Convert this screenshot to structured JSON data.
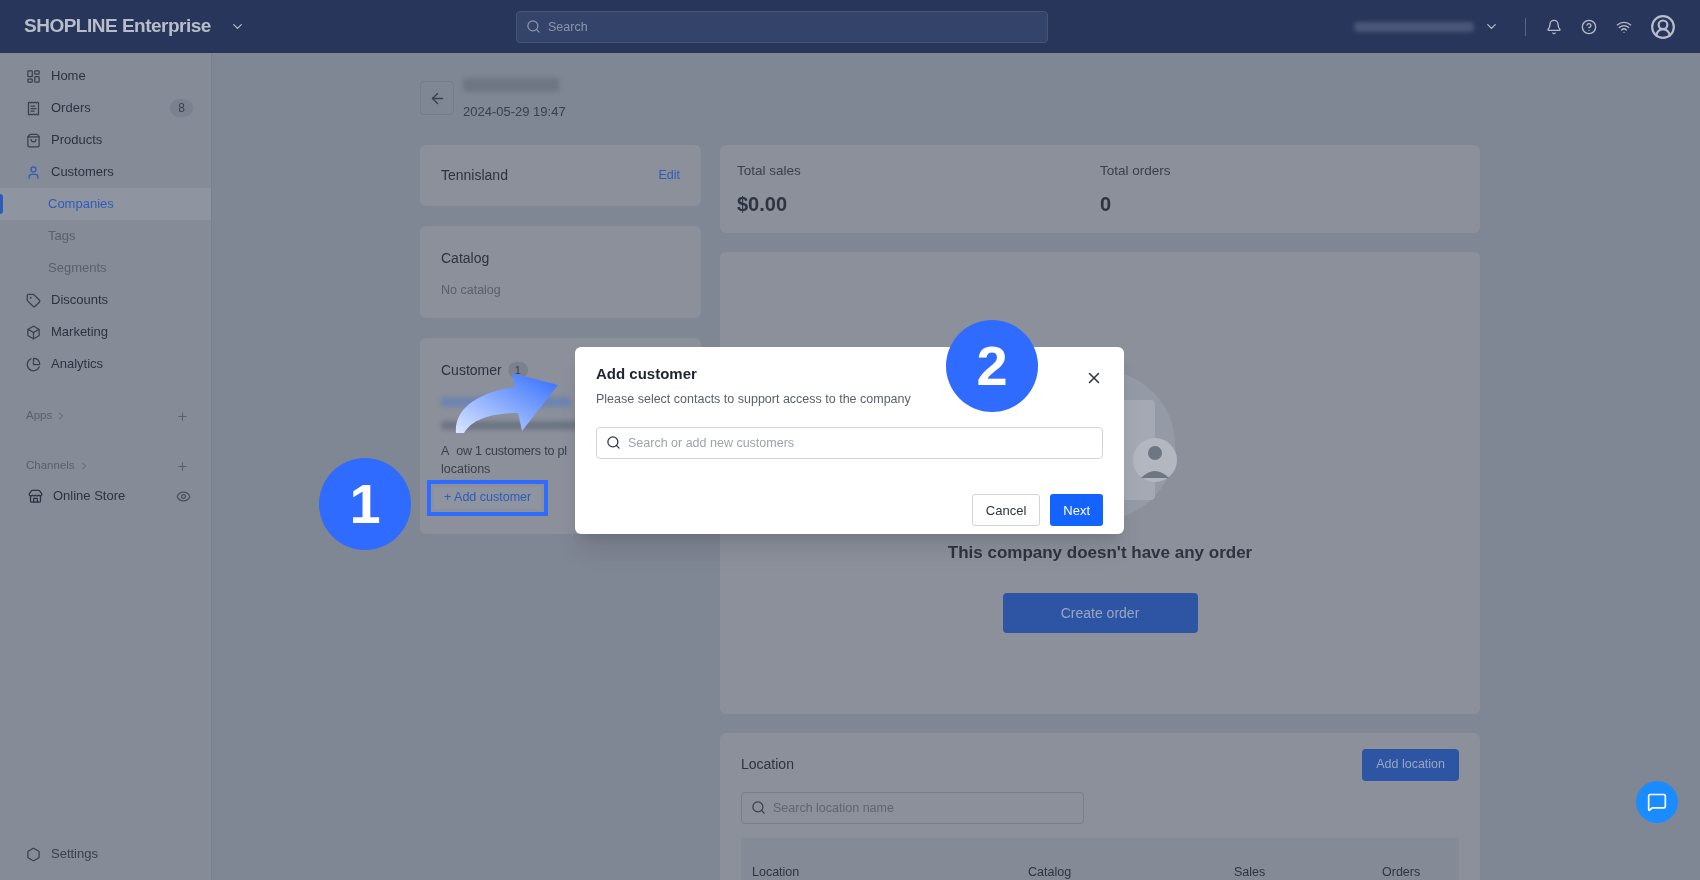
{
  "topbar": {
    "logo": "SHOPLINE Enterprise",
    "search_placeholder": "Search"
  },
  "sidebar": {
    "items": [
      {
        "label": "Home"
      },
      {
        "label": "Orders",
        "badge": "8"
      },
      {
        "label": "Products"
      },
      {
        "label": "Customers",
        "children": [
          {
            "label": "Companies",
            "selected": true
          },
          {
            "label": "Tags",
            "selected": false
          },
          {
            "label": "Segments",
            "selected": false
          }
        ]
      },
      {
        "label": "Discounts"
      },
      {
        "label": "Marketing"
      },
      {
        "label": "Analytics"
      }
    ],
    "sections": [
      {
        "label": "Apps"
      },
      {
        "label": "Channels",
        "items": [
          {
            "label": "Online Store"
          }
        ]
      }
    ],
    "settings": "Settings"
  },
  "page": {
    "date": "2024-05-29 19:47",
    "company_card": {
      "name": "Tennisland",
      "action": "Edit"
    },
    "catalog_card": {
      "title": "Catalog",
      "value": "No catalog"
    },
    "customers_card": {
      "title": "Customer",
      "count": "1",
      "note_line_1": [
        "A",
        "ow 1 customers to pl"
      ],
      "note_line_2": "locations",
      "button": "+ Add customer"
    },
    "stats": [
      {
        "label": "Total sales",
        "value": "$0.00"
      },
      {
        "label": "Total orders",
        "value": "0"
      }
    ],
    "orders": {
      "message": "This company doesn't have any order",
      "button": "Create order"
    },
    "location": {
      "title": "Location",
      "button": "Add location",
      "search_placeholder": "Search location name",
      "columns": [
        "Location",
        "Catalog",
        "Sales",
        "Orders"
      ]
    }
  },
  "modal": {
    "title": "Add customer",
    "subtitle": "Please select contacts to support access to the company",
    "search_placeholder": "Search or add new customers",
    "buttons": [
      {
        "label": "Cancel",
        "kind": "secondary"
      },
      {
        "label": "Next",
        "kind": "primary"
      }
    ]
  },
  "steps": [
    "1",
    "2"
  ]
}
